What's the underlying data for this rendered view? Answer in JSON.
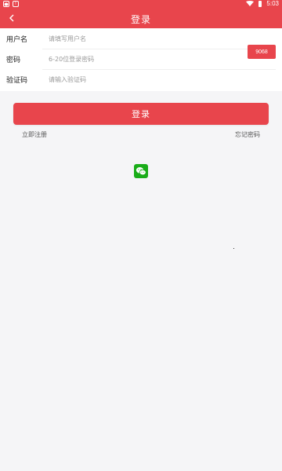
{
  "status_bar": {
    "time": "5:03",
    "left_icons": [
      "chat-notification-icon",
      "alert-notification-icon"
    ]
  },
  "header": {
    "title": "登录",
    "back_icon": "chevron-left-icon"
  },
  "form": {
    "username": {
      "label": "用户名",
      "value": "",
      "placeholder": "请填写用户名"
    },
    "password": {
      "label": "密码",
      "value": "",
      "placeholder": "6-20位登录密码"
    },
    "captcha": {
      "label": "验证码",
      "value": "",
      "placeholder": "请输入验证码",
      "code": "9068"
    }
  },
  "actions": {
    "login_label": "登录",
    "register_label": "立即注册",
    "forgot_label": "忘记密码"
  },
  "social": {
    "wechat_icon": "wechat-icon"
  },
  "colors": {
    "brand": "#e8454c",
    "background": "#f5f5f7",
    "wechat": "#1aad19"
  }
}
